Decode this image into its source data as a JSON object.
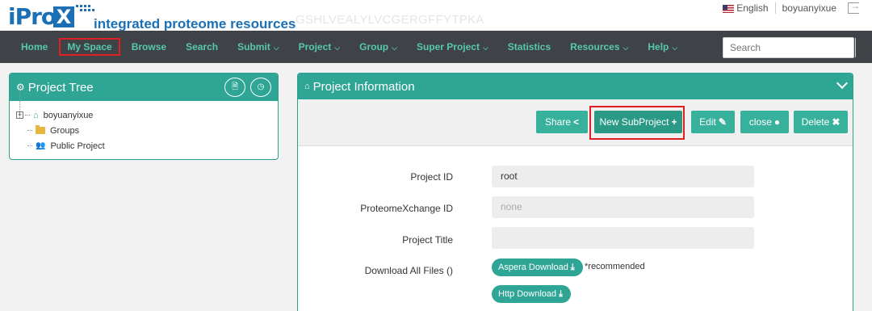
{
  "header": {
    "logo_text": "iPro",
    "logo_x": "X",
    "tagline": "integrated proteome resources",
    "sequence_watermark": "GSHLVEALYLVCGERGFFYTPKA",
    "language": "English",
    "username": "boyuanyixue"
  },
  "nav": {
    "items": [
      {
        "label": "Home",
        "dropdown": false,
        "highlighted": false
      },
      {
        "label": "My Space",
        "dropdown": false,
        "highlighted": true
      },
      {
        "label": "Browse",
        "dropdown": false,
        "highlighted": false
      },
      {
        "label": "Search",
        "dropdown": false,
        "highlighted": false
      },
      {
        "label": "Submit",
        "dropdown": true,
        "highlighted": false
      },
      {
        "label": "Project",
        "dropdown": true,
        "highlighted": false
      },
      {
        "label": "Group",
        "dropdown": true,
        "highlighted": false
      },
      {
        "label": "Super Project",
        "dropdown": true,
        "highlighted": false
      },
      {
        "label": "Statistics",
        "dropdown": false,
        "highlighted": false
      },
      {
        "label": "Resources",
        "dropdown": true,
        "highlighted": false
      },
      {
        "label": "Help",
        "dropdown": true,
        "highlighted": false
      }
    ],
    "search_placeholder": "Search"
  },
  "project_tree": {
    "title": "Project Tree",
    "root": "boyuanyixue",
    "children": [
      "Groups",
      "Public Project"
    ]
  },
  "project_info": {
    "title": "Project Information",
    "buttons": {
      "share": "Share",
      "new_subproject": "New SubProject",
      "edit": "Edit",
      "close": "close",
      "delete": "Delete"
    },
    "fields": {
      "project_id_label": "Project ID",
      "project_id_value": "root",
      "px_id_label": "ProteomeXchange ID",
      "px_id_value": "none",
      "title_label": "Project Title",
      "title_value": "",
      "download_label": "Download All Files ()"
    },
    "downloads": {
      "aspera": "Aspera Download",
      "recommended": "*recommended",
      "http": "Http Download"
    }
  },
  "colors": {
    "teal": "#2fa596",
    "nav_bg": "#3f4347",
    "nav_text": "#56c9a9",
    "highlight_red": "#e02020",
    "brand_blue": "#1a6fb5"
  }
}
